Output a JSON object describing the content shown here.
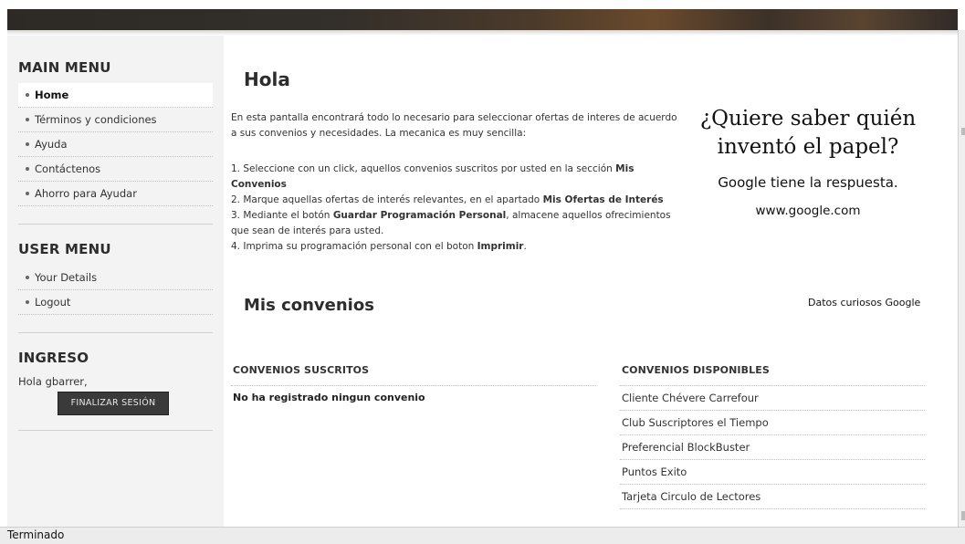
{
  "sidebar": {
    "main_menu": {
      "title": "MAIN MENU",
      "items": [
        {
          "label": "Home"
        },
        {
          "label": "Términos y condiciones"
        },
        {
          "label": "Ayuda"
        },
        {
          "label": "Contáctenos"
        },
        {
          "label": "Ahorro para Ayudar"
        }
      ]
    },
    "user_menu": {
      "title": "USER MENU",
      "items": [
        {
          "label": "Your Details"
        },
        {
          "label": "Logout"
        }
      ]
    },
    "login": {
      "title": "INGRESO",
      "greeting": "Hola gbarrer,",
      "logout_button": "FINALIZAR SESIÓN"
    }
  },
  "main": {
    "title": "Hola",
    "intro": "En esta pantalla encontrará todo lo necesario para seleccionar ofertas de interes de acuerdo a sus convenios y necesidades. La mecanica es muy sencilla:",
    "steps": [
      {
        "pre": "1. Seleccione con un click, aquellos convenios suscritos por usted en la sección ",
        "bold": "Mis Convenios",
        "post": ""
      },
      {
        "pre": "2. Marque aquellas ofertas de interés relevantes, en el apartado ",
        "bold": "Mis Ofertas de Interés",
        "post": ""
      },
      {
        "pre": "3. Mediante el botón ",
        "bold": "Guardar Programación Personal",
        "post": ", almacene aquellos ofrecimientos que sean de interés para usted."
      },
      {
        "pre": "4. Imprima su programación personal con el boton ",
        "bold": "Imprimir",
        "post": "."
      }
    ],
    "section_title": "Mis convenios",
    "subscribed": {
      "header": "CONVENIOS SUSCRITOS",
      "empty_message": "No ha registrado ningun convenio"
    },
    "available": {
      "header": "CONVENIOS DISPONIBLES",
      "items": [
        "Cliente Chévere Carrefour",
        "Club Suscriptores el Tiempo",
        "Preferencial BlockBuster",
        "Puntos Exito",
        "Tarjeta Circulo de Lectores"
      ]
    }
  },
  "ad": {
    "headline": "¿Quiere saber quién inventó el papel?",
    "line": "Google tiene la respuesta.",
    "url": "www.google.com",
    "credit": "Datos curiosos Google"
  },
  "status_bar": {
    "text": "Terminado"
  }
}
